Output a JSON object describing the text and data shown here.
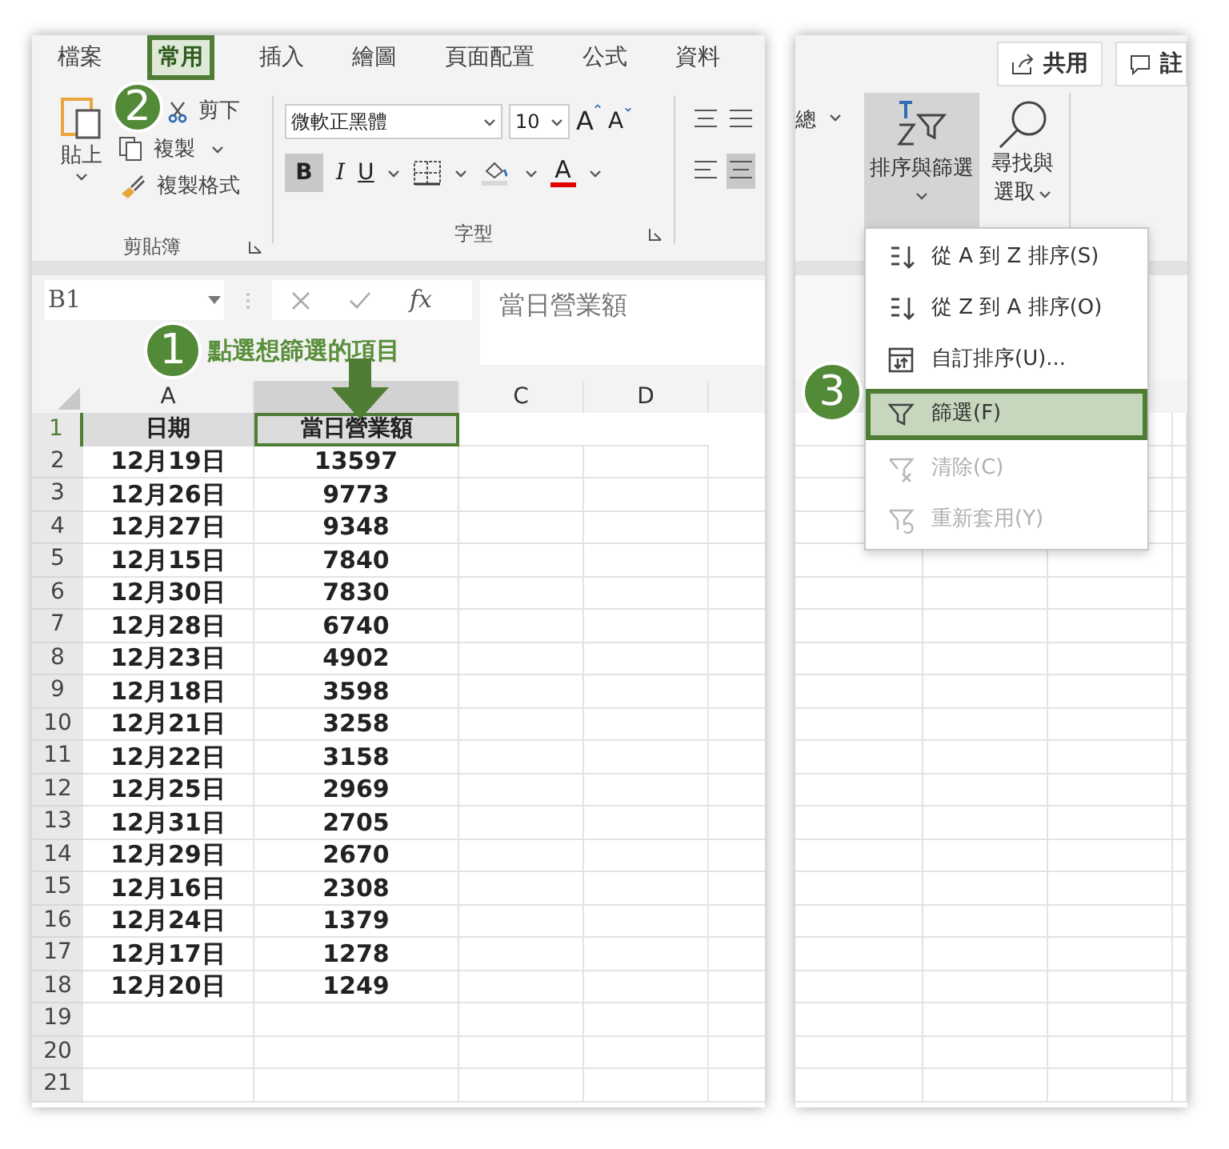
{
  "left": {
    "tabs": [
      {
        "label": "檔案",
        "selected": false
      },
      {
        "label": "常用",
        "selected": true
      },
      {
        "label": "插入",
        "selected": false
      },
      {
        "label": "繪圖",
        "selected": false
      },
      {
        "label": "頁面配置",
        "selected": false
      },
      {
        "label": "公式",
        "selected": false
      },
      {
        "label": "資料",
        "selected": false
      }
    ],
    "clipboard": {
      "paste": "貼上",
      "cut": "剪下",
      "copy": "複製",
      "format_painter": "複製格式",
      "label": "剪貼簿"
    },
    "font": {
      "name": "微軟正黑體",
      "size": "10",
      "grow": "A",
      "shrink": "A",
      "bold": {
        "label": "B",
        "selected": true
      },
      "italic": "I",
      "underline": "U",
      "font_color": "A",
      "label": "字型"
    },
    "formula_bar": {
      "name_box": "B1",
      "fx": "fx",
      "value": "當日營業額"
    },
    "columns": [
      {
        "label": "A",
        "selected": false
      },
      {
        "selected": true
      },
      {
        "label": "C",
        "selected": false
      },
      {
        "label": "D",
        "selected": false
      }
    ],
    "header_row": {
      "number": "1",
      "cells": [
        "日期",
        "當日營業額"
      ]
    },
    "rows": [
      {
        "number": "2",
        "cells": [
          "12月19日",
          "13597"
        ]
      },
      {
        "number": "3",
        "cells": [
          "12月26日",
          "9773"
        ]
      },
      {
        "number": "4",
        "cells": [
          "12月27日",
          "9348"
        ]
      },
      {
        "number": "5",
        "cells": [
          "12月15日",
          "7840"
        ]
      },
      {
        "number": "6",
        "cells": [
          "12月30日",
          "7830"
        ]
      },
      {
        "number": "7",
        "cells": [
          "12月28日",
          "6740"
        ]
      },
      {
        "number": "8",
        "cells": [
          "12月23日",
          "4902"
        ]
      },
      {
        "number": "9",
        "cells": [
          "12月18日",
          "3598"
        ]
      },
      {
        "number": "10",
        "cells": [
          "12月21日",
          "3258"
        ]
      },
      {
        "number": "11",
        "cells": [
          "12月22日",
          "3158"
        ]
      },
      {
        "number": "12",
        "cells": [
          "12月25日",
          "2969"
        ]
      },
      {
        "number": "13",
        "cells": [
          "12月31日",
          "2705"
        ]
      },
      {
        "number": "14",
        "cells": [
          "12月29日",
          "2670"
        ]
      },
      {
        "number": "15",
        "cells": [
          "12月16日",
          "2308"
        ]
      },
      {
        "number": "16",
        "cells": [
          "12月24日",
          "1379"
        ]
      },
      {
        "number": "17",
        "cells": [
          "12月17日",
          "1278"
        ]
      },
      {
        "number": "18",
        "cells": [
          "12月20日",
          "1249"
        ]
      },
      {
        "number": "19"
      },
      {
        "number": "20"
      },
      {
        "number": "21"
      }
    ]
  },
  "steps": [
    {
      "number": "1",
      "text": "點選想篩選的項目"
    },
    {
      "number": "2"
    },
    {
      "number": "3"
    }
  ],
  "right": {
    "share": "共用",
    "comment": "註",
    "ribbon_partial": "總",
    "sort_filter": {
      "label": "排序與篩選",
      "selected": true
    },
    "find_select": [
      "尋找與",
      "選取"
    ],
    "menu": [
      {
        "label": "從 A 到 Z 排序(S)",
        "selected": false,
        "disabled": false
      },
      {
        "label": "從 Z 到 A 排序(O)",
        "selected": false,
        "disabled": false
      },
      {
        "label": "自訂排序(U)...",
        "selected": false,
        "disabled": false
      },
      {
        "label": "篩選(F)",
        "selected": true,
        "disabled": false
      },
      {
        "label": "清除(C)",
        "selected": false,
        "disabled": true
      },
      {
        "label": "重新套用(Y)",
        "selected": false,
        "disabled": true
      }
    ]
  }
}
